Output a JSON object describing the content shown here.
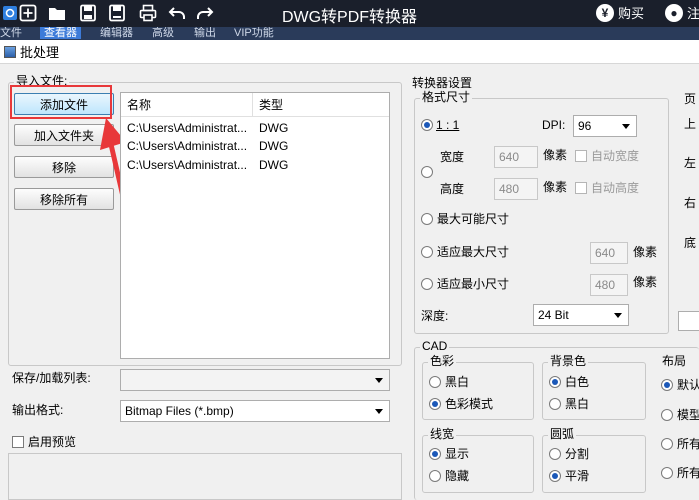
{
  "app": {
    "title": "DWG转PDF转换器",
    "buy_label": "购买",
    "register_label": "注",
    "buy_icon_glyph": "¥"
  },
  "toolbar_icons": [
    "logo-icon",
    "add-icon",
    "open-folder-icon",
    "save-icon",
    "save-as-icon",
    "print-icon",
    "undo-icon",
    "redo-icon"
  ],
  "menu": {
    "items": [
      "文件",
      "查看器",
      "编辑器",
      "高级",
      "输出",
      "VIP功能"
    ],
    "active_index": 1
  },
  "dialog": {
    "title": "批处理"
  },
  "import": {
    "group_label": "导入文件:",
    "add_file": "添加文件",
    "add_folder": "加入文件夹",
    "remove": "移除",
    "remove_all": "移除所有",
    "columns": [
      "名称",
      "类型"
    ],
    "rows": [
      {
        "name": "C:\\Users\\Administrat...",
        "type": "DWG"
      },
      {
        "name": "C:\\Users\\Administrat...",
        "type": "DWG"
      },
      {
        "name": "C:\\Users\\Administrat...",
        "type": "DWG"
      }
    ]
  },
  "save_load_list": {
    "label": "保存/加载列表:",
    "value": ""
  },
  "output_format": {
    "label": "输出格式:",
    "value": "Bitmap Files (*.bmp)"
  },
  "preview": {
    "label": "启用预览",
    "checked": false
  },
  "converter": {
    "group_label": "转换器设置",
    "format_size": {
      "label": "格式尺寸",
      "ratio_label": "1 : 1",
      "dpi_label": "DPI:",
      "dpi_value": "96",
      "width_label": "宽度",
      "width_value": "640",
      "height_label": "高度",
      "height_value": "480",
      "px_label": "像素",
      "auto_width": "自动宽度",
      "auto_height": "自动高度",
      "max_possible": "最大可能尺寸",
      "fit_max": "适应最大尺寸",
      "fit_max_value": "640",
      "fit_min": "适应最小尺寸",
      "fit_min_value": "480",
      "depth_label": "深度:",
      "depth_value": "24 Bit",
      "selected": "ratio"
    },
    "page": {
      "label": "页",
      "items": [
        "上",
        "左",
        "右",
        "底"
      ]
    }
  },
  "cad": {
    "group_label": "CAD",
    "color": {
      "label": "色彩",
      "options": [
        "黑白",
        "色彩模式"
      ],
      "selected": 1
    },
    "background": {
      "label": "背景色",
      "options": [
        "白色",
        "黑白"
      ],
      "selected": 0
    },
    "layout": {
      "label": "布局",
      "options": [
        "默认",
        "模型",
        "所有",
        "所有"
      ],
      "selected": 0
    },
    "line_width": {
      "label": "线宽",
      "options": [
        "显示",
        "隐藏"
      ],
      "selected": 0
    },
    "arc": {
      "label": "圆弧",
      "options": [
        "分割",
        "平滑"
      ],
      "selected": 1
    }
  },
  "colors": {
    "topbar": "#1a1f2b",
    "highlight": "#e8383a",
    "radio_dot": "#1b58b8"
  }
}
